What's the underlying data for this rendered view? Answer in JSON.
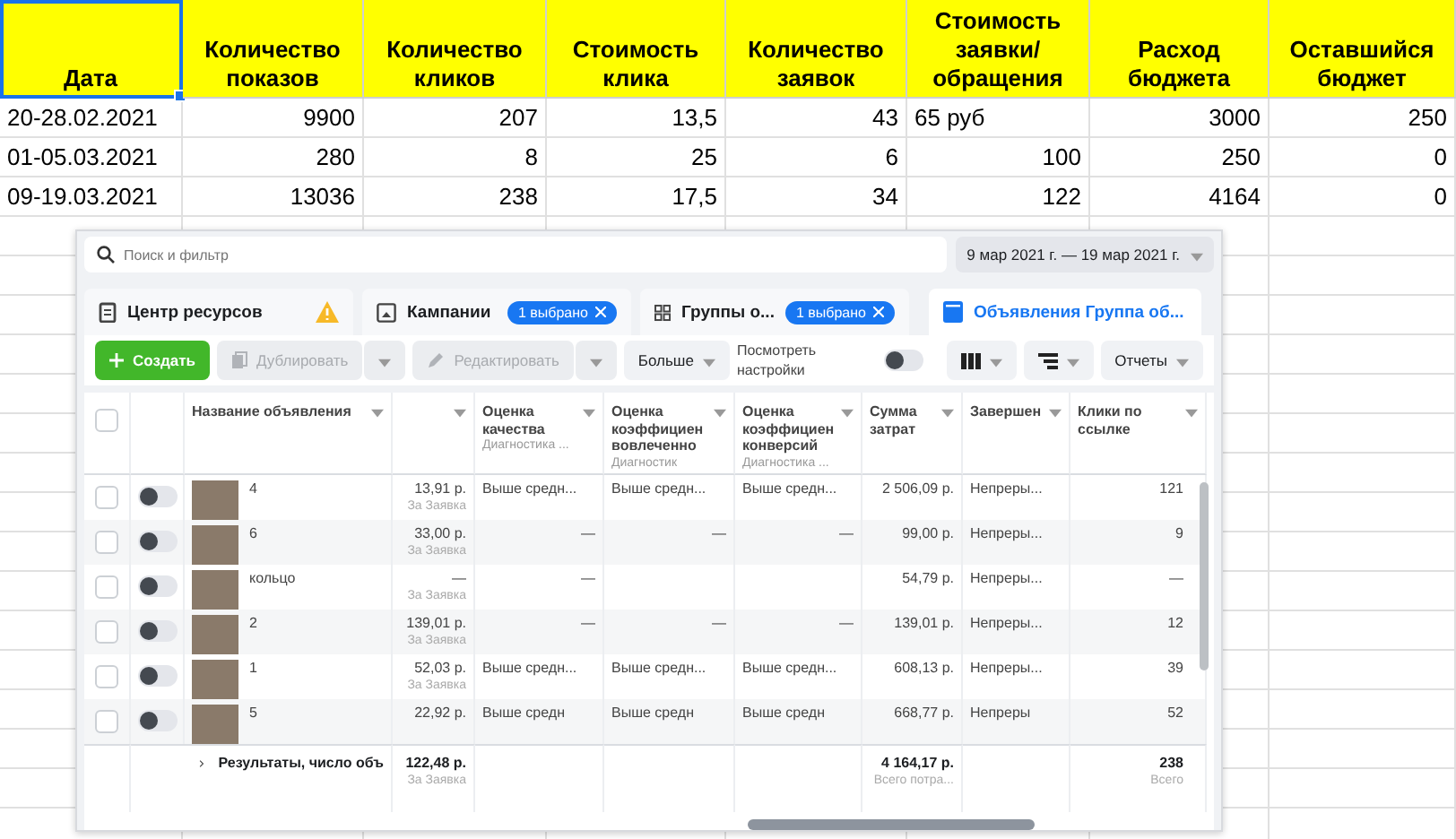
{
  "sheet": {
    "header": [
      {
        "label": "Дата",
        "selected": true
      },
      {
        "label": "Количество показов",
        "selected": false
      },
      {
        "label": "Количество кликов",
        "selected": false
      },
      {
        "label": "Стоимость клика",
        "selected": false
      },
      {
        "label": "Количество заявок",
        "selected": false
      },
      {
        "label": "Стоимость заявки/обращения",
        "selected": false
      },
      {
        "label": "Расход бюджета",
        "selected": false
      },
      {
        "label": "Оставшийся бюджет",
        "selected": false
      }
    ],
    "rows": [
      [
        {
          "v": "20-28.02.2021",
          "kind": "text"
        },
        {
          "v": "9900",
          "kind": "number"
        },
        {
          "v": "207",
          "kind": "number"
        },
        {
          "v": "13,5",
          "kind": "number"
        },
        {
          "v": "43",
          "kind": "number"
        },
        {
          "v": "65 руб",
          "kind": "text"
        },
        {
          "v": "3000",
          "kind": "number"
        },
        {
          "v": "250",
          "kind": "number"
        }
      ],
      [
        {
          "v": "01-05.03.2021",
          "kind": "text"
        },
        {
          "v": "280",
          "kind": "number"
        },
        {
          "v": "8",
          "kind": "number"
        },
        {
          "v": "25",
          "kind": "number"
        },
        {
          "v": "6",
          "kind": "number"
        },
        {
          "v": "100",
          "kind": "number"
        },
        {
          "v": "250",
          "kind": "number"
        },
        {
          "v": "0",
          "kind": "number"
        }
      ],
      [
        {
          "v": "09-19.03.2021",
          "kind": "text"
        },
        {
          "v": "13036",
          "kind": "number"
        },
        {
          "v": "238",
          "kind": "number"
        },
        {
          "v": "17,5",
          "kind": "number"
        },
        {
          "v": "34",
          "kind": "number"
        },
        {
          "v": "122",
          "kind": "number"
        },
        {
          "v": "4164",
          "kind": "number"
        },
        {
          "v": "0",
          "kind": "number"
        }
      ]
    ]
  },
  "ads_manager": {
    "search": {
      "placeholder": "Поиск и фильтр"
    },
    "date_range": "9 мар 2021 г. — 19 мар 2021 г.",
    "tabs": [
      {
        "label": "Центр ресурсов",
        "kind": "resources",
        "selected": false,
        "warning": true
      },
      {
        "label": "Кампании",
        "kind": "campaigns",
        "selected": false,
        "chip": "1 выбрано"
      },
      {
        "label": "Группы о...",
        "kind": "groups",
        "selected": false,
        "chip": "1 выбрано"
      },
      {
        "label": "Объявления Группа об...",
        "kind": "ads",
        "selected": true
      }
    ],
    "toolbar": [
      {
        "label": "Создать",
        "kind": "create",
        "disabled": false
      },
      {
        "label": "Дублировать",
        "kind": "duplicate",
        "disabled": true
      },
      {
        "label": "Редактировать",
        "kind": "edit",
        "disabled": true
      },
      {
        "label": "Больше",
        "kind": "more",
        "disabled": false
      }
    ],
    "view_settings": {
      "label": "Посмотреть настройки",
      "on": false
    },
    "reports": "Отчеты",
    "select_all": {
      "checked": false
    },
    "columns": [
      {
        "title": "Название объявления"
      },
      {},
      {
        "title": "Оценка качества",
        "subtitle": "Диагностика ..."
      },
      {
        "title": "Оценка коэффициен вовлеченно",
        "subtitle": "Диагностик"
      },
      {
        "title": "Оценка коэффициен конверсий",
        "subtitle": "Диагностика ..."
      },
      {
        "title": "Сумма затрат"
      },
      {
        "title": "Завершен"
      },
      {
        "title": "Клики по ссылке"
      }
    ],
    "rows": [
      {
        "checked": false,
        "on": false,
        "name": "4",
        "column_2": {
          "value": "13,91 р.",
          "note": "За Заявка"
        },
        "quality": "Выше средн...",
        "engagement": "Выше средн...",
        "conversion": "Выше средн...",
        "spend": "2 506,09 р.",
        "delivery": "Непреры...",
        "clicks": "121"
      },
      {
        "checked": false,
        "on": false,
        "name": "6",
        "column_2": {
          "value": "33,00 р.",
          "note": "За Заявка"
        },
        "quality": "—",
        "engagement": "—",
        "conversion": "—",
        "spend": "99,00 р.",
        "delivery": "Непреры...",
        "clicks": "9"
      },
      {
        "checked": false,
        "on": false,
        "name": "кольцо",
        "column_2": {
          "value": "—",
          "note": "За Заявка"
        },
        "quality": "—",
        "spend": "54,79 р.",
        "delivery": "Непреры...",
        "clicks": "—"
      },
      {
        "checked": false,
        "on": false,
        "name": "2",
        "column_2": {
          "value": "139,01 р.",
          "note": "За Заявка"
        },
        "quality": "—",
        "engagement": "—",
        "conversion": "—",
        "spend": "139,01 р.",
        "delivery": "Непреры...",
        "clicks": "12"
      },
      {
        "checked": false,
        "on": false,
        "name": "1",
        "column_2": {
          "value": "52,03 р.",
          "note": "За Заявка"
        },
        "quality": "Выше средн...",
        "engagement": "Выше средн...",
        "conversion": "Выше средн...",
        "spend": "608,13 р.",
        "delivery": "Непреры...",
        "clicks": "39"
      },
      {
        "checked": false,
        "on": false,
        "name": "5",
        "column_2": {
          "value": "22,92 р."
        },
        "quality": "Выше средн",
        "engagement": "Выше средн",
        "conversion": "Выше средн",
        "spend": "668,77 р.",
        "delivery": "Непреры",
        "clicks": "52"
      }
    ],
    "summary": {
      "label": "Результаты, число объ",
      "column_2": {
        "value": "122,48 р.",
        "note": "За Заявка"
      },
      "spend": {
        "value": "4 164,17 р.",
        "note": "Всего потра..."
      },
      "clicks": {
        "value": "238",
        "note": "Всего"
      }
    }
  }
}
